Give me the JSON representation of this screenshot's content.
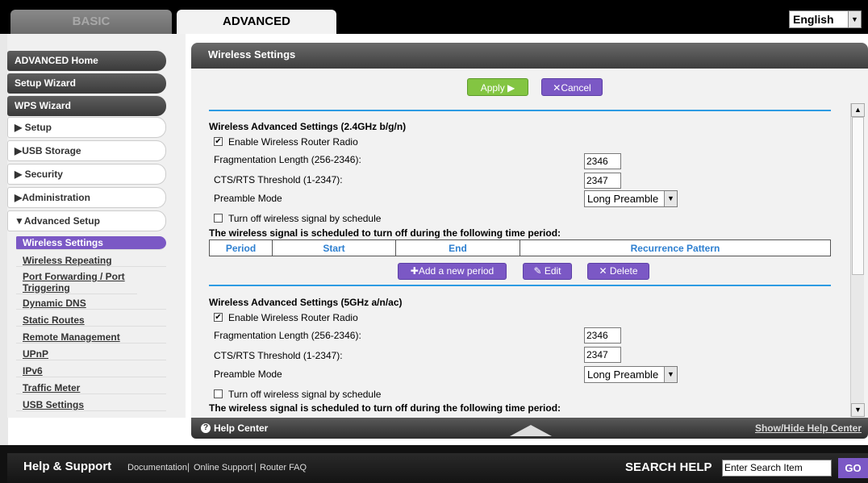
{
  "top_tabs": {
    "basic": "BASIC",
    "advanced": "ADVANCED"
  },
  "language": {
    "selected": "English"
  },
  "sidebar": {
    "dark_items": [
      "ADVANCED Home",
      "Setup Wizard",
      "WPS Wizard"
    ],
    "sections": [
      "▶ Setup",
      "▶USB Storage",
      "▶ Security",
      "▶Administration",
      "▼Advanced Setup"
    ],
    "sub_items": [
      "Wireless Settings",
      "Wireless Repeating",
      "Port Forwarding / Port Triggering",
      "Dynamic DNS",
      "Static Routes",
      "Remote Management",
      "UPnP",
      "IPv6",
      "Traffic Meter",
      "USB Settings"
    ]
  },
  "main": {
    "title": "Wireless Settings",
    "apply_label": "Apply ▶",
    "cancel_label": "✕Cancel",
    "band24": {
      "title": "Wireless Advanced Settings (2.4GHz b/g/n)",
      "enable_radio_label": "Enable Wireless Router Radio",
      "enable_radio_checked": true,
      "frag_label": "Fragmentation Length (256-2346):",
      "frag_value": "2346",
      "cts_label": "CTS/RTS Threshold (1-2347):",
      "cts_value": "2347",
      "preamble_label": "Preamble Mode",
      "preamble_value": "Long Preamble",
      "schedule_label": "Turn off wireless signal by schedule",
      "schedule_checked": false,
      "schedule_notice": "The wireless signal is scheduled to turn off during the following time period:",
      "table_headers": [
        "Period",
        "Start",
        "End",
        "Recurrence Pattern"
      ],
      "add_period_label": "✚Add a new period",
      "edit_label": "✎ Edit",
      "delete_label": "✕ Delete"
    },
    "band5": {
      "title": "Wireless Advanced Settings (5GHz a/n/ac)",
      "enable_radio_label": "Enable Wireless Router Radio",
      "enable_radio_checked": true,
      "frag_label": "Fragmentation Length (256-2346):",
      "frag_value": "2346",
      "cts_label": "CTS/RTS Threshold (1-2347):",
      "cts_value": "2347",
      "preamble_label": "Preamble Mode",
      "preamble_value": "Long Preamble",
      "schedule_label": "Turn off wireless signal by schedule",
      "schedule_checked": false,
      "schedule_notice": "The wireless signal is scheduled to turn off during the following time period:"
    }
  },
  "help_center": {
    "label": "Help Center",
    "toggle": "Show/Hide Help Center"
  },
  "footer": {
    "title": "Help & Support",
    "links": [
      "Documentation",
      "Online Support",
      "Router FAQ"
    ],
    "search_label": "SEARCH HELP",
    "search_value": "Enter Search Item",
    "go_label": "GO"
  },
  "colors": {
    "accent_purple": "#7b58c5",
    "apply_green": "#83c542",
    "line_blue": "#2d9be3"
  }
}
